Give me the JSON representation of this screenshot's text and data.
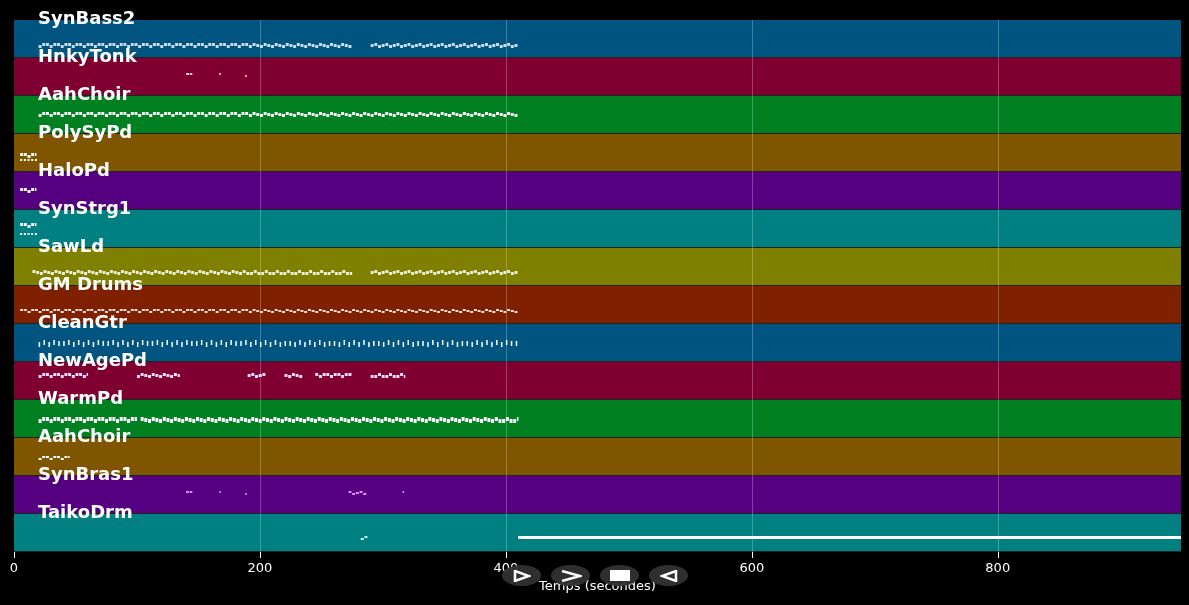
{
  "tracks": [
    {
      "name": "SynBass2",
      "color": "#005580"
    },
    {
      "name": "HnkyTonk",
      "color": "#7f0030"
    },
    {
      "name": "AahChoir",
      "color": "#008020"
    },
    {
      "name": "PolySyPd",
      "color": "#7f5500"
    },
    {
      "name": "HaloPd",
      "color": "#550080"
    },
    {
      "name": "SynStrg1",
      "color": "#008080"
    },
    {
      "name": "SawLd",
      "color": "#808000"
    },
    {
      "name": "GM Drums",
      "color": "#7f2000"
    },
    {
      "name": "CleanGtr",
      "color": "#005580"
    },
    {
      "name": "NewAgePd",
      "color": "#7f0030"
    },
    {
      "name": "WarmPd",
      "color": "#008020"
    },
    {
      "name": "AahChoir",
      "color": "#7f5500"
    },
    {
      "name": "SynBras1",
      "color": "#550080"
    },
    {
      "name": "TaikoDrm",
      "color": "#008080"
    }
  ],
  "x_axis": {
    "label": "Temps (secondes)",
    "ticks": [
      "0",
      "200",
      "400",
      "600",
      "800"
    ]
  },
  "controls": [
    {
      "kind": "play"
    },
    {
      "kind": "next"
    },
    {
      "kind": "stop"
    },
    {
      "kind": "back"
    }
  ]
}
